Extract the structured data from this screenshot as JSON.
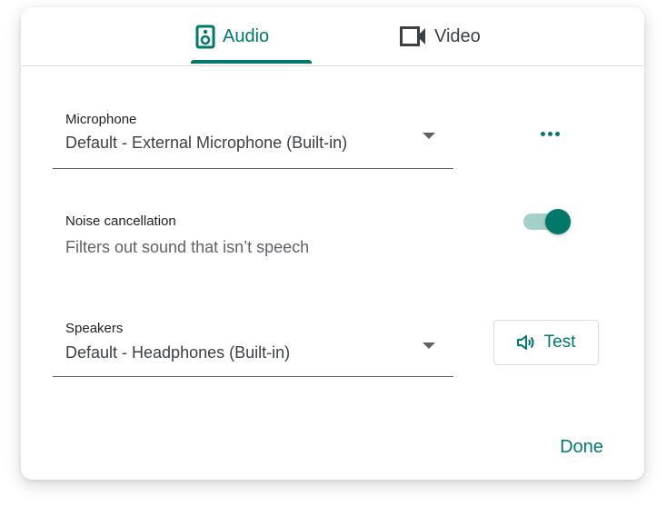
{
  "tabs": {
    "audio": {
      "label": "Audio",
      "icon": "speaker-icon",
      "active": true
    },
    "video": {
      "label": "Video",
      "icon": "videocam-icon",
      "active": false
    }
  },
  "microphone": {
    "label": "Microphone",
    "value": "Default - External Microphone (Built-in)",
    "more_icon": "more-horizontal-icon"
  },
  "noise_cancellation": {
    "label": "Noise cancellation",
    "description": "Filters out sound that isn’t speech",
    "enabled": true
  },
  "speakers": {
    "label": "Speakers",
    "value": "Default - Headphones (Built-in)",
    "test_label": "Test",
    "test_icon": "volume-icon"
  },
  "footer": {
    "done_label": "Done"
  },
  "colors": {
    "accent": "#00796b",
    "accent_light": "#a3d0c8",
    "text_primary": "#202124",
    "text_secondary": "#5f6368",
    "divider": "#dadce0"
  }
}
